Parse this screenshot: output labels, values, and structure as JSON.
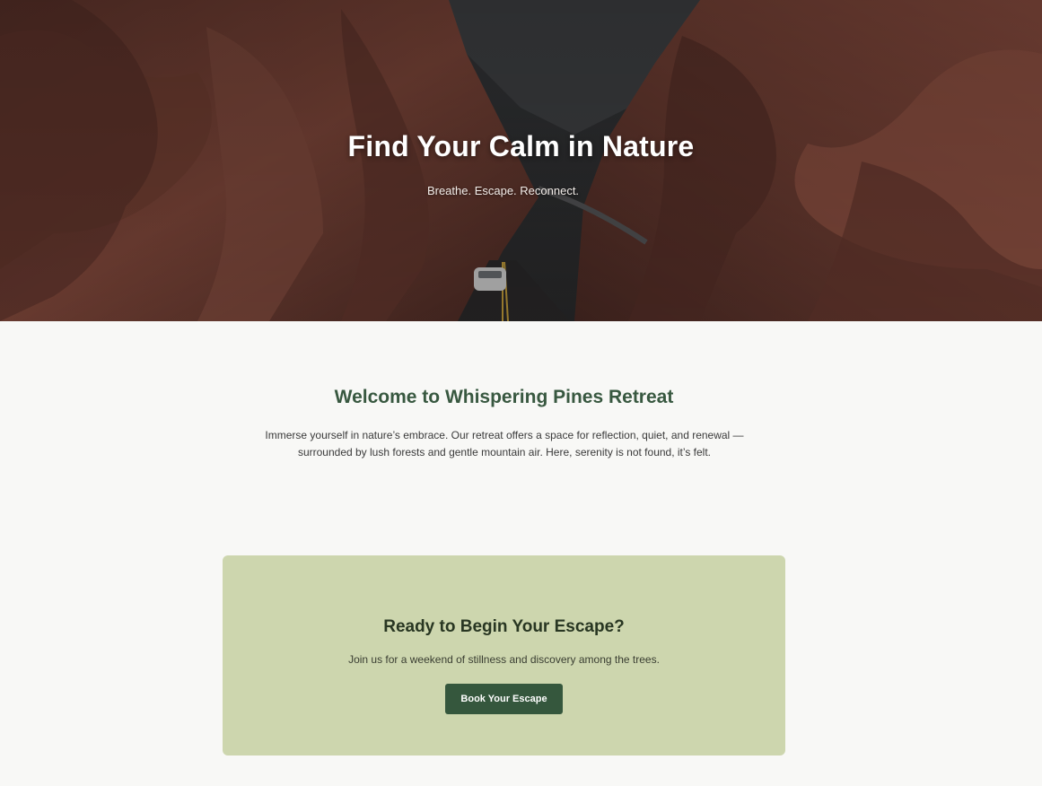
{
  "hero": {
    "title": "Find Your Calm in Nature",
    "subtitle": "Breathe. Escape. Reconnect."
  },
  "welcome": {
    "title": "Welcome to Whispering Pines Retreat",
    "text": "Immerse yourself in nature’s embrace. Our retreat offers a space for reflection, quiet, and renewal — surrounded by lush forests and gentle mountain air. Here, serenity is not found, it’s felt."
  },
  "cta": {
    "title": "Ready to Begin Your Escape?",
    "text": "Join us for a weekend of stillness and discovery among the trees.",
    "button_label": "Book Your Escape"
  },
  "colors": {
    "accent_green": "#35573d",
    "heading_green": "#385840",
    "cta_background": "#cdd6ae",
    "page_background": "#f8f8f6"
  }
}
